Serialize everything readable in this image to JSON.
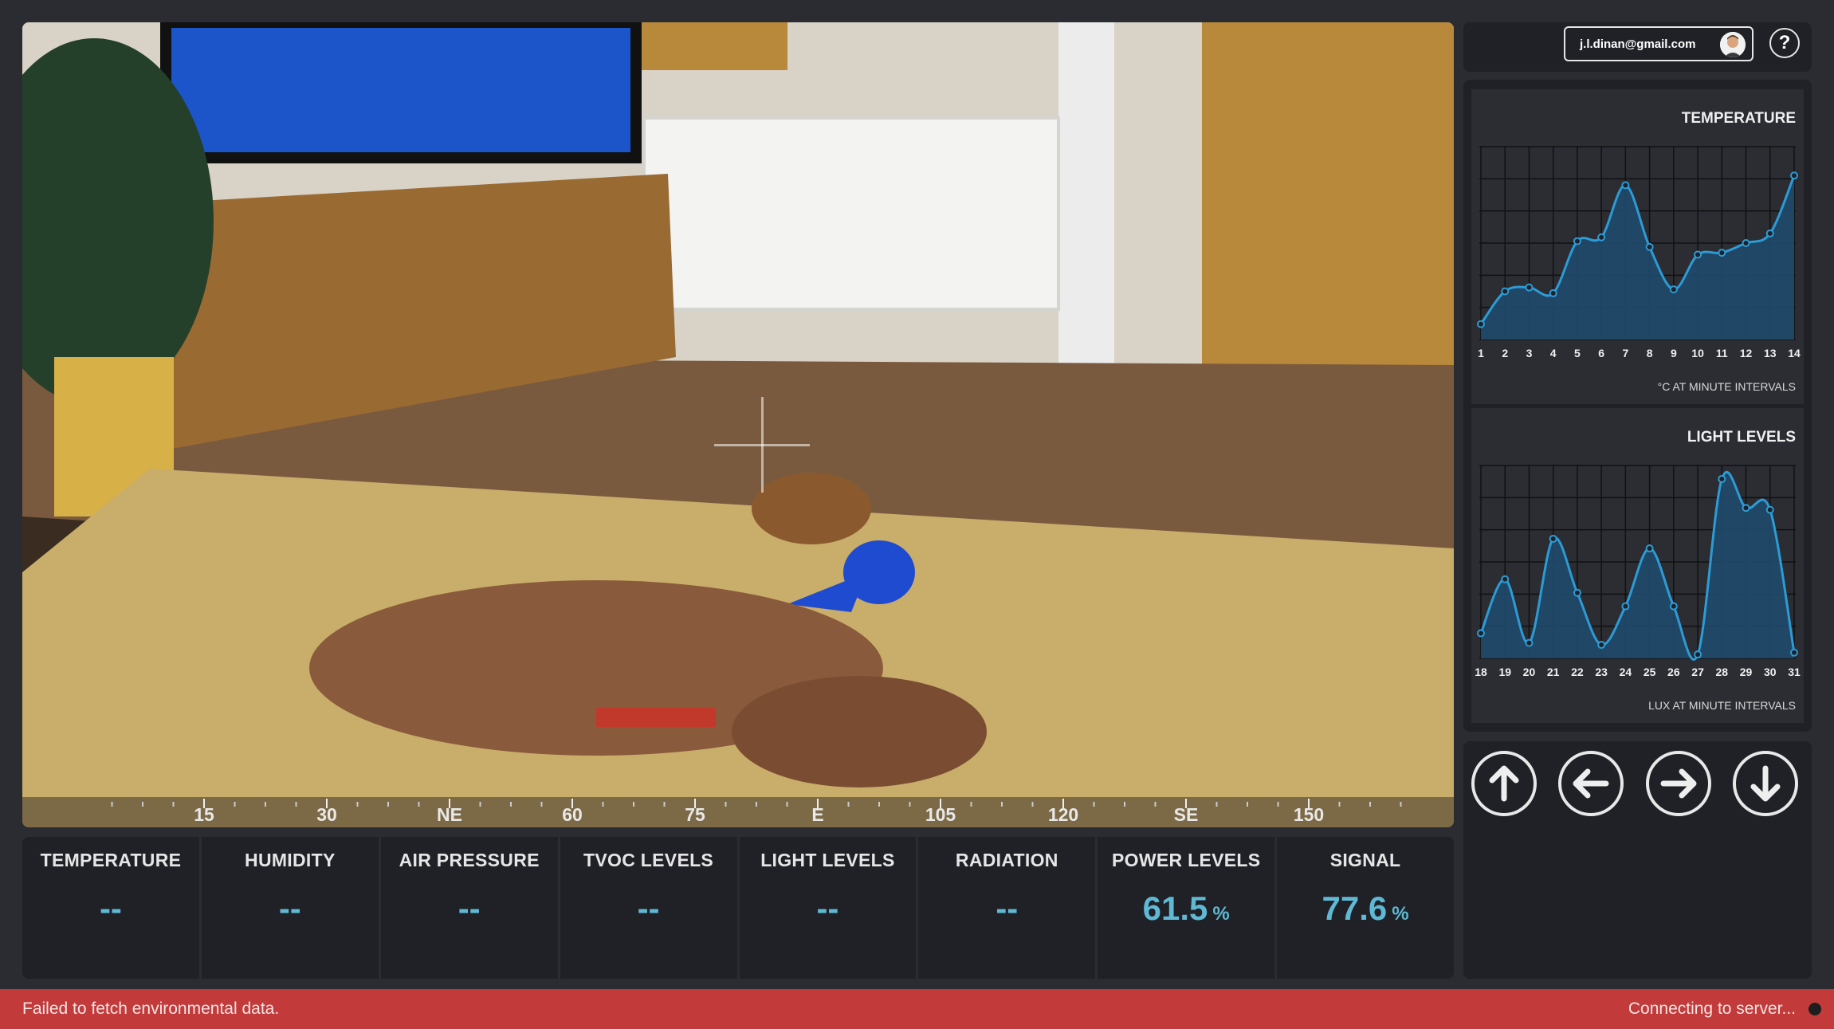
{
  "account": {
    "email": "j.l.dinan@gmail.com",
    "avatar_icon": "avatar-icon",
    "help_label": "?"
  },
  "compass": {
    "labels": [
      "15",
      "30",
      "NE",
      "60",
      "75",
      "E",
      "105",
      "120",
      "SE",
      "150"
    ]
  },
  "sensors": [
    {
      "label": "TEMPERATURE",
      "value": "--",
      "unit": ""
    },
    {
      "label": "HUMIDITY",
      "value": "--",
      "unit": ""
    },
    {
      "label": "AIR PRESSURE",
      "value": "--",
      "unit": ""
    },
    {
      "label": "TVOC LEVELS",
      "value": "--",
      "unit": ""
    },
    {
      "label": "LIGHT LEVELS",
      "value": "--",
      "unit": ""
    },
    {
      "label": "RADIATION",
      "value": "--",
      "unit": ""
    },
    {
      "label": "POWER LEVELS",
      "value": "61.5",
      "unit": "%"
    },
    {
      "label": "SIGNAL",
      "value": "77.6",
      "unit": "%"
    }
  ],
  "chart_data": [
    {
      "type": "area",
      "title": "TEMPERATURE",
      "note": "°C AT MINUTE INTERVALS",
      "x": [
        "1",
        "2",
        "3",
        "4",
        "5",
        "6",
        "7",
        "8",
        "9",
        "10",
        "11",
        "12",
        "13",
        "14"
      ],
      "values": [
        8,
        25,
        27,
        24,
        51,
        53,
        80,
        48,
        26,
        44,
        45,
        50,
        55,
        85
      ],
      "ylim": [
        0,
        100
      ],
      "grid": true,
      "color": "#2c9bd6",
      "fill": "#1f4a6b"
    },
    {
      "type": "area",
      "title": "LIGHT LEVELS",
      "note": "LUX AT MINUTE INTERVALS",
      "x": [
        "18",
        "19",
        "20",
        "21",
        "22",
        "23",
        "24",
        "25",
        "26",
        "27",
        "28",
        "29",
        "30",
        "31"
      ],
      "values": [
        13,
        41,
        8,
        62,
        34,
        7,
        27,
        57,
        27,
        2,
        93,
        78,
        77,
        3
      ],
      "ylim": [
        0,
        100
      ],
      "grid": true,
      "color": "#2c9bd6",
      "fill": "#1f4a6b"
    }
  ],
  "controls": [
    {
      "name": "up-button",
      "icon": "arrow-up-icon"
    },
    {
      "name": "left-button",
      "icon": "arrow-left-icon"
    },
    {
      "name": "right-button",
      "icon": "arrow-right-icon"
    },
    {
      "name": "down-button",
      "icon": "arrow-down-icon"
    }
  ],
  "status": {
    "error": "Failed to fetch environmental data.",
    "connection": "Connecting to server..."
  }
}
